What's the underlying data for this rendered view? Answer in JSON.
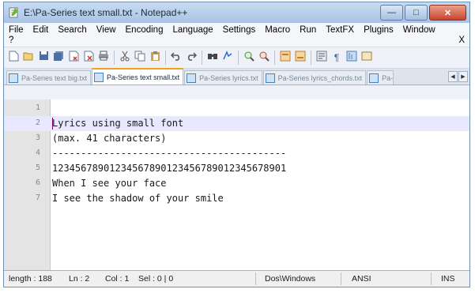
{
  "window": {
    "title": "E:\\Pa-Series text small.txt - Notepad++"
  },
  "menu": {
    "items": [
      "File",
      "Edit",
      "Search",
      "View",
      "Encoding",
      "Language",
      "Settings",
      "Macro",
      "Run",
      "TextFX",
      "Plugins",
      "Window"
    ],
    "help": "?",
    "close_doc": "X"
  },
  "toolbar": {
    "icons": [
      "new-file-icon",
      "open-file-icon",
      "save-icon",
      "save-all-icon",
      "close-icon",
      "close-all-icon",
      "print-icon",
      "cut-icon",
      "copy-icon",
      "paste-icon",
      "undo-icon",
      "redo-icon",
      "find-icon",
      "replace-icon",
      "zoom-in-icon",
      "zoom-out-icon",
      "sync-v-icon",
      "sync-h-icon",
      "word-wrap-icon",
      "show-all-icon",
      "indent-guide-icon",
      "user-lang-icon"
    ]
  },
  "tabs": [
    {
      "label": "Pa-Series text big.txt",
      "active": false
    },
    {
      "label": "Pa-Series text small.txt",
      "active": true
    },
    {
      "label": "Pa-Series lyrics.txt",
      "active": false
    },
    {
      "label": "Pa-Series lyrics_chords.txt",
      "active": false
    },
    {
      "label": "Pa-",
      "active": false
    }
  ],
  "editor": {
    "current_line": 2,
    "lines": [
      {
        "num": "1",
        "text": ""
      },
      {
        "num": "2",
        "text": "Lyrics using small font"
      },
      {
        "num": "3",
        "text": "(max. 41 characters)"
      },
      {
        "num": "4",
        "text": "-----------------------------------------"
      },
      {
        "num": "5",
        "text": "12345678901234567890123456789012345678901"
      },
      {
        "num": "6",
        "text": "When I see your face"
      },
      {
        "num": "7",
        "text": "I see the shadow of your smile"
      }
    ]
  },
  "status": {
    "length": "length : 188",
    "ln": "Ln : 2",
    "col": "Col : 1",
    "sel": "Sel : 0 | 0",
    "eol": "Dos\\Windows",
    "encoding": "ANSI",
    "mode": "INS"
  },
  "colors": {
    "current_line_bg": "#e8e8ff",
    "active_tab_accent": "#f0a020",
    "titlebar": "#a9c3e4"
  }
}
